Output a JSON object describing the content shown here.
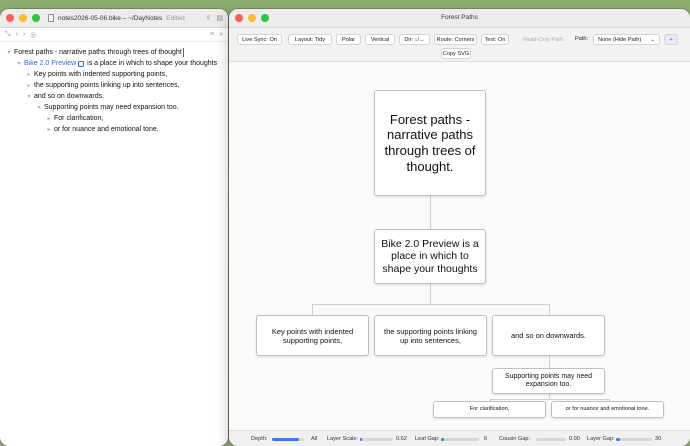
{
  "left_window": {
    "title": "notes2026-05-06.bike – ~/DayNotes",
    "status": "Edited",
    "outline": [
      {
        "level": 0,
        "text": "Forest paths - narrative paths through trees of thought"
      },
      {
        "level": 1,
        "link": "Bike 2.0 Preview",
        "text": "is a place in which to shape your thoughts"
      },
      {
        "level": 2,
        "text": "Key points with indented supporting points,"
      },
      {
        "level": 2,
        "text": "the supporting points linking up into sentences,"
      },
      {
        "level": 2,
        "text": "and so on downwards."
      },
      {
        "level": 3,
        "text": "Supporting points may need expansion too."
      },
      {
        "level": 4,
        "text": "For clarification,"
      },
      {
        "level": 4,
        "text": "or for nuance and emotional tone."
      }
    ]
  },
  "right_window": {
    "title": "Forest Paths",
    "toolbar": {
      "live_sync": "Live Sync: On",
      "layout": "Layout: Tidy",
      "polar": "Polar",
      "vertical": "Vertical",
      "dir": "Dir: ↓/→",
      "route": "Route: Corners",
      "text": "Text: On",
      "read_only": "Read-Only Path",
      "path_label": "Path:",
      "path_value": "None (Hide Path)",
      "plus": "+",
      "copy_svg": "Copy SVG"
    },
    "tree": {
      "root": "Forest paths - narrative paths through trees of thought.",
      "child": "Bike 2.0 Preview is a place in which to shape your thoughts",
      "grandchildren": [
        "Key points with indented supporting points,",
        "the supporting points linking up into sentences,",
        "and so on downwards."
      ],
      "great": "Supporting points may need expansion too.",
      "leaves": [
        "For clarification,",
        "or for nuance and emotional tone."
      ]
    },
    "status": {
      "depth_label": "Depth:",
      "depth_fill": 0.85,
      "depth_value": "All",
      "layer_scale_label": "Layer Scale:",
      "layer_scale_value": "0.62",
      "leaf_gap_label": "Leaf Gap:",
      "leaf_gap_value": "6",
      "cousin_gap_label": "Cousin Gap:",
      "cousin_gap_value": "0.00",
      "layer_gap_label": "Layer Gap:",
      "layer_gap_value": "30"
    }
  }
}
